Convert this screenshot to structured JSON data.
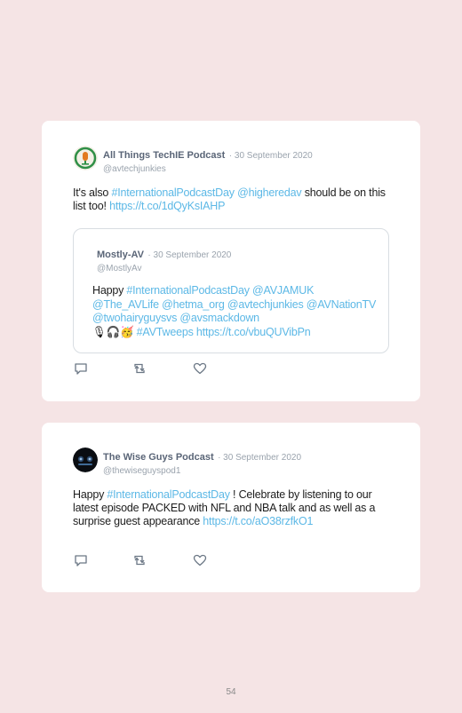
{
  "tweets": [
    {
      "author": "All Things TechIE Podcast",
      "date": "· 30 September 2020",
      "handle": "@avtechjunkies",
      "text_before": "It's also ",
      "hashtag": "#InternationalPodcastDay",
      "sep": " ",
      "mention": "@higheredav",
      "text_after": " should be on this list too! ",
      "url": "https://t.co/1dQyKsIAHP",
      "quoted": {
        "author": "Mostly-AV",
        "date": "· 30 September 2020",
        "handle": "@MostlyAv",
        "text_before": "Happy ",
        "links1": "#InternationalPodcastDay @AVJAMUK @The_AVLife @hetma_org @avtechjunkies @AVNationTV @twohairyguysvs @avsmackdown",
        "emoji": "🎙🎧🥳",
        "links2": " #AVTweeps https://t.co/vbuQUVibPn"
      }
    },
    {
      "author": "The Wise Guys Podcast",
      "date": "· 30 September 2020",
      "handle": "@thewiseguyspod1",
      "text_before": "Happy ",
      "hashtag": "#InternationalPodcastDay",
      "text_after": " ! Celebrate by listening to our latest episode PACKED with NFL and NBA talk and as well as a surprise guest appearance ",
      "url": "https://t.co/aO38rzfkO1"
    }
  ],
  "icons": [
    "reply-icon",
    "retweet-icon",
    "like-icon"
  ],
  "colors": {
    "background": "#f5e4e5",
    "link": "#5cb8e6",
    "card": "#ffffff"
  },
  "page_number": "54"
}
